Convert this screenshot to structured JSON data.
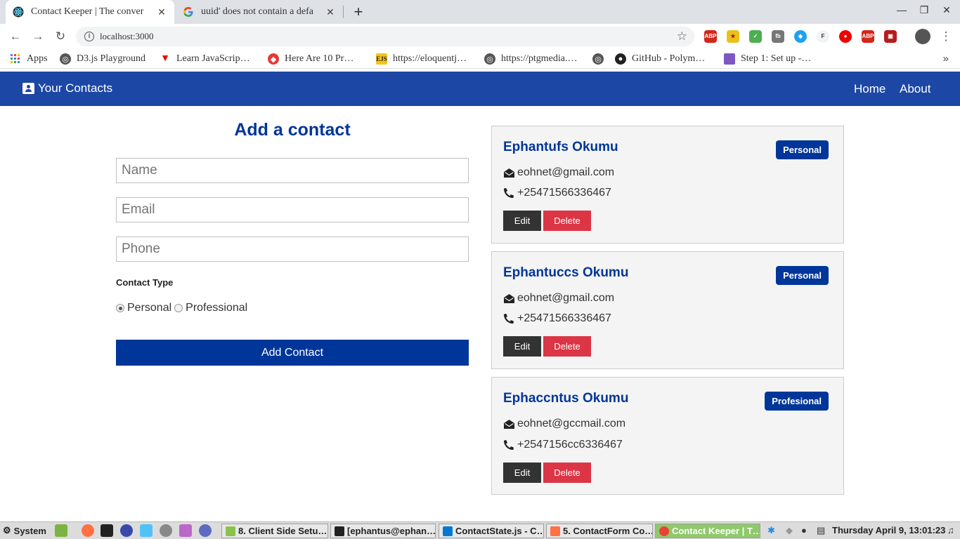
{
  "browser": {
    "tabs": [
      {
        "title": "Contact Keeper | The conver",
        "favicon": "react-icon",
        "active": true
      },
      {
        "title": "uuid' does not contain a defa",
        "favicon": "google-icon",
        "active": false
      }
    ],
    "url": "localhost:3000",
    "bookmarks": [
      {
        "label": "Apps",
        "icon": "apps-grid-icon"
      },
      {
        "label": "D3.js Playground",
        "icon": "globe-icon"
      },
      {
        "label": "Learn JavaScrip…",
        "icon": "red-triangle-icon"
      },
      {
        "label": "Here Are 10 Pr…",
        "icon": "red-bird-icon"
      },
      {
        "label": "https://eloquentj…",
        "icon": "ejs-icon"
      },
      {
        "label": "https://ptgmedia.…",
        "icon": "globe-icon"
      },
      {
        "label": "GitHub - Polym…",
        "icon": "github-icon"
      },
      {
        "label": "Step 1: Set up -…",
        "icon": "purple-square-icon"
      }
    ],
    "extensions": [
      "abp-icon",
      "vpn-icon",
      "pushbullet-icon",
      "fb-icon",
      "twitter-bird-icon",
      "font-icon",
      "ublock-icon",
      "abp-red-icon",
      "photo-icon"
    ]
  },
  "app": {
    "brand": "Your Contacts",
    "nav": {
      "home": "Home",
      "about": "About"
    },
    "form": {
      "title": "Add a contact",
      "name_placeholder": "Name",
      "email_placeholder": "Email",
      "phone_placeholder": "Phone",
      "type_label": "Contact Type",
      "option_personal": "Personal",
      "option_professional": "Professional",
      "selected": "personal",
      "submit": "Add Contact"
    },
    "contacts": [
      {
        "name": "Ephantufs Okumu",
        "type": "Personal",
        "email": "eohnet@gmail.com",
        "phone": "+25471566336467"
      },
      {
        "name": "Ephantuccs Okumu",
        "type": "Personal",
        "email": "eohnet@gmail.com",
        "phone": "+25471566336467"
      },
      {
        "name": "Ephaccntus Okumu",
        "type": "Profesional",
        "email": "eohnet@gccmail.com",
        "phone": "+2547156cc6336467"
      }
    ],
    "edit_label": "Edit",
    "delete_label": "Delete"
  },
  "taskbar": {
    "menu": "System",
    "tasks": [
      "8. Client Side Setu…",
      "[ephantus@ephan…",
      "ContactState.js - C…",
      "5. ContactForm Co…",
      "Contact Keeper | T…"
    ],
    "clock": "Thursday April  9, 13:01:23"
  },
  "colors": {
    "nav_bg": "#1c47a5",
    "primary": "#003699",
    "danger": "#dc3545",
    "dark": "#333333",
    "card_bg": "#f4f4f4"
  }
}
